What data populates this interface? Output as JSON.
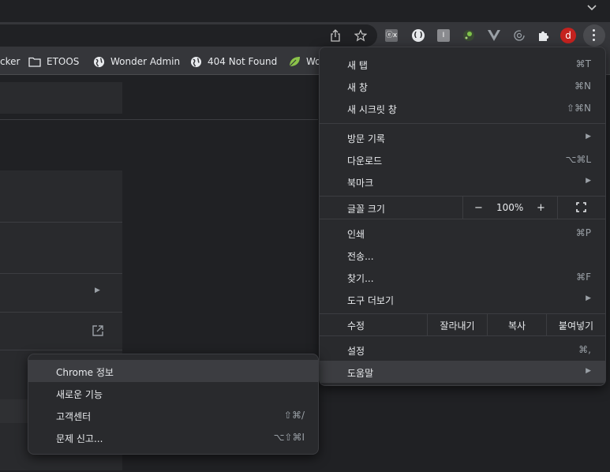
{
  "window": {
    "collapse_icon": "⌄"
  },
  "toolbar": {
    "avatar_letter": "d",
    "ext1_text": "ⓔx",
    "ext2_text": "( )",
    "ext3_text": "I"
  },
  "bookmarks": [
    {
      "label": "cker",
      "icon": "none"
    },
    {
      "label": "ETOOS",
      "icon": "folder-icon"
    },
    {
      "label": "Wonder Admin",
      "icon": "globe-icon"
    },
    {
      "label": "404 Not Found",
      "icon": "globe-icon"
    },
    {
      "label": "Wo",
      "icon": "leaf-icon"
    }
  ],
  "menu": {
    "new_tab": {
      "label": "새 탭",
      "shortcut": "⌘T"
    },
    "new_window": {
      "label": "새 창",
      "shortcut": "⌘N"
    },
    "new_incognito": {
      "label": "새 시크릿 창",
      "shortcut": "⇧⌘N"
    },
    "history": {
      "label": "방문 기록",
      "arrow": "▶"
    },
    "downloads": {
      "label": "다운로드",
      "shortcut": "⌥⌘L"
    },
    "bookmarks": {
      "label": "북마크",
      "arrow": "▶"
    },
    "zoom": {
      "label": "글꼴 크기",
      "minus": "−",
      "value": "100%",
      "plus": "+"
    },
    "print": {
      "label": "인쇄",
      "shortcut": "⌘P"
    },
    "cast": {
      "label": "전송..."
    },
    "find": {
      "label": "찾기...",
      "shortcut": "⌘F"
    },
    "more_tools": {
      "label": "도구 더보기",
      "arrow": "▶"
    },
    "edit": {
      "label": "수정",
      "cut": "잘라내기",
      "copy": "복사",
      "paste": "붙여넣기"
    },
    "settings": {
      "label": "설정",
      "shortcut": "⌘,"
    },
    "help": {
      "label": "도움말",
      "arrow": "▶"
    }
  },
  "help_submenu": {
    "about": {
      "label": "Chrome 정보"
    },
    "whats_new": {
      "label": "새로운 기능"
    },
    "help_center": {
      "label": "고객센터",
      "shortcut": "⇧⌘/"
    },
    "report_issue": {
      "label": "문제 신고...",
      "shortcut": "⌥⇧⌘I"
    }
  },
  "page": {
    "row_arrow": "▶"
  }
}
